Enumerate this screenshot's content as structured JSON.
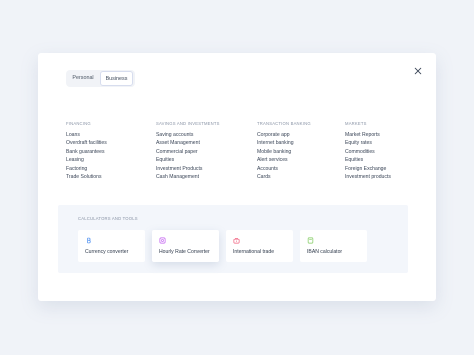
{
  "toggle": {
    "personal": "Personal",
    "business": "Business",
    "selected": "Business"
  },
  "columns": [
    {
      "heading": "FINANCING",
      "links": [
        "Loans",
        "Overdraft facilities",
        "Bank guarantees",
        "Leasing",
        "Factoring",
        "Trade Solutions"
      ]
    },
    {
      "heading": "SAVINGS AND INVESTMENTS",
      "links": [
        "Saving accounts",
        "Asset Management",
        "Commercial paper",
        "Equities",
        "Investment Products",
        "Cash Management"
      ]
    },
    {
      "heading": "TRANSACTION BANKING",
      "links": [
        "Corporate app",
        "Internet banking",
        "Mobile banking",
        "Alert services",
        "Accounts",
        "Cards"
      ]
    },
    {
      "heading": "MARKETS",
      "links": [
        "Market Reports",
        "Equity rates",
        "Commodities",
        "Equities",
        "Foreign Exchange",
        "Investment products"
      ]
    }
  ],
  "tools": {
    "heading": "CALCULATORS AND TOOLS",
    "cards": [
      {
        "label": "Currency converter",
        "icon": "currency-icon",
        "color": "#4a8df0"
      },
      {
        "label": "Hourly Rate Converter",
        "icon": "clock-icon",
        "color": "#c15cf0"
      },
      {
        "label": "International trade",
        "icon": "briefcase-icon",
        "color": "#f05a7a"
      },
      {
        "label": "IBAN calculator",
        "icon": "calculator-icon",
        "color": "#7cc95a"
      }
    ]
  },
  "close_icon": "close-icon"
}
